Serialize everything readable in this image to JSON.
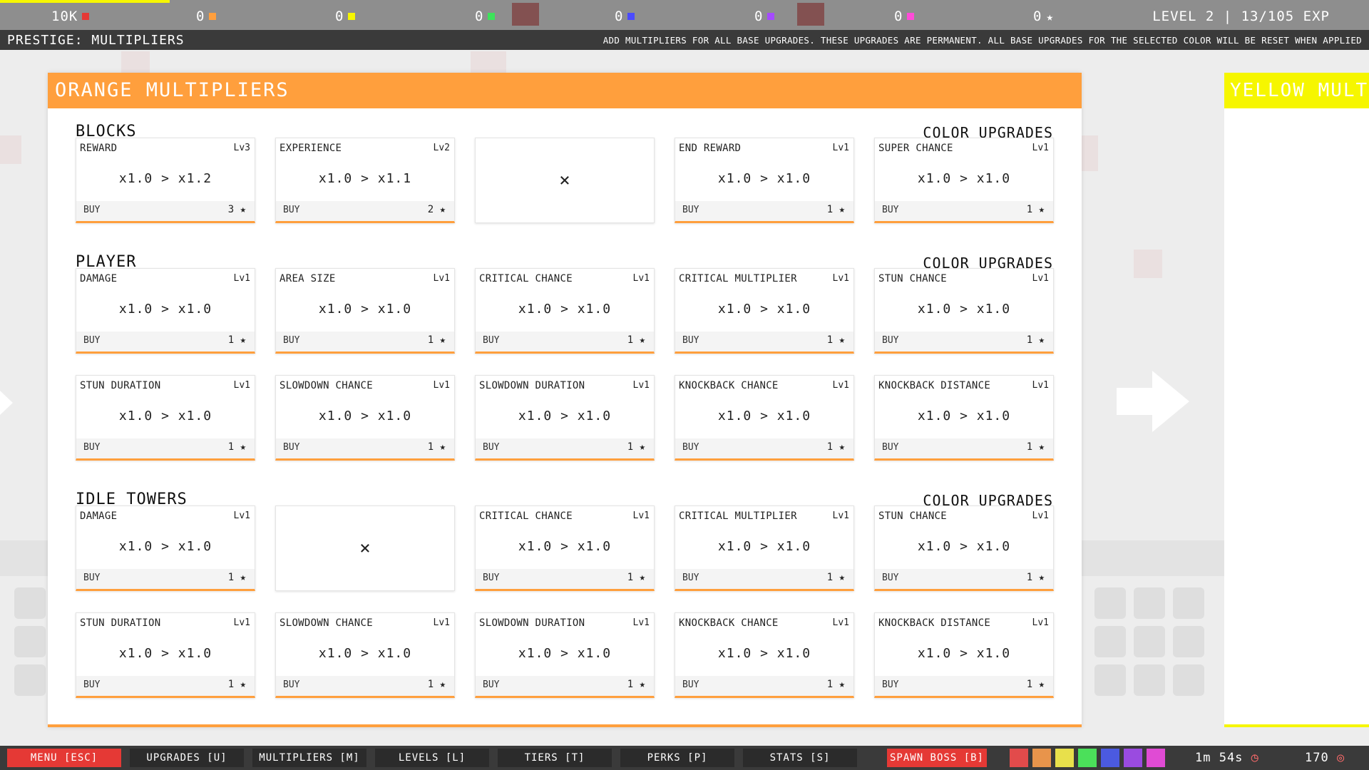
{
  "topbar": {
    "resources": [
      {
        "value": "10K",
        "color": "#e53935"
      },
      {
        "value": "0",
        "color": "#ff9f3d"
      },
      {
        "value": "0",
        "color": "#f6f600"
      },
      {
        "value": "0",
        "color": "#3de25a"
      },
      {
        "value": "0",
        "color": "#4b4bff"
      },
      {
        "value": "0",
        "color": "#a54bff"
      },
      {
        "value": "0",
        "color": "#ff4bd8"
      },
      {
        "value": "0",
        "icon": "star-icon"
      }
    ],
    "level_text": "LEVEL 2 | 13/105 EXP"
  },
  "subbar": {
    "title": "PRESTIGE: MULTIPLIERS",
    "description": "ADD MULTIPLIERS FOR ALL BASE UPGRADES. THESE UPGRADES ARE PERMANENT. ALL BASE UPGRADES FOR THE SELECTED COLOR WILL BE RESET WHEN APPLIED"
  },
  "panel": {
    "title": "ORANGE MULTIPLIERS",
    "accent": "#ff9f3d",
    "buy_label": "BUY",
    "color_upgrades_label": "COLOR UPGRADES",
    "sections": [
      {
        "title": "BLOCKS",
        "rows": [
          [
            {
              "name": "REWARD",
              "lv": "Lv3",
              "value": "x1.0 > x1.2",
              "cost": "3"
            },
            {
              "name": "EXPERIENCE",
              "lv": "Lv2",
              "value": "x1.0 > x1.1",
              "cost": "2"
            },
            {
              "empty": true,
              "mark": "×"
            },
            {
              "name": "END REWARD",
              "lv": "Lv1",
              "value": "x1.0 > x1.0",
              "cost": "1"
            },
            {
              "name": "SUPER CHANCE",
              "lv": "Lv1",
              "value": "x1.0 > x1.0",
              "cost": "1"
            }
          ]
        ]
      },
      {
        "title": "PLAYER",
        "rows": [
          [
            {
              "name": "DAMAGE",
              "lv": "Lv1",
              "value": "x1.0 > x1.0",
              "cost": "1"
            },
            {
              "name": "AREA SIZE",
              "lv": "Lv1",
              "value": "x1.0 > x1.0",
              "cost": "1"
            },
            {
              "name": "CRITICAL CHANCE",
              "lv": "Lv1",
              "value": "x1.0 > x1.0",
              "cost": "1"
            },
            {
              "name": "CRITICAL MULTIPLIER",
              "lv": "Lv1",
              "value": "x1.0 > x1.0",
              "cost": "1"
            },
            {
              "name": "STUN CHANCE",
              "lv": "Lv1",
              "value": "x1.0 > x1.0",
              "cost": "1"
            }
          ],
          [
            {
              "name": "STUN DURATION",
              "lv": "Lv1",
              "value": "x1.0 > x1.0",
              "cost": "1"
            },
            {
              "name": "SLOWDOWN CHANCE",
              "lv": "Lv1",
              "value": "x1.0 > x1.0",
              "cost": "1"
            },
            {
              "name": "SLOWDOWN DURATION",
              "lv": "Lv1",
              "value": "x1.0 > x1.0",
              "cost": "1"
            },
            {
              "name": "KNOCKBACK CHANCE",
              "lv": "Lv1",
              "value": "x1.0 > x1.0",
              "cost": "1"
            },
            {
              "name": "KNOCKBACK DISTANCE",
              "lv": "Lv1",
              "value": "x1.0 > x1.0",
              "cost": "1"
            }
          ]
        ]
      },
      {
        "title": "IDLE TOWERS",
        "rows": [
          [
            {
              "name": "DAMAGE",
              "lv": "Lv1",
              "value": "x1.0 > x1.0",
              "cost": "1"
            },
            {
              "empty": true,
              "mark": "×"
            },
            {
              "name": "CRITICAL CHANCE",
              "lv": "Lv1",
              "value": "x1.0 > x1.0",
              "cost": "1"
            },
            {
              "name": "CRITICAL MULTIPLIER",
              "lv": "Lv1",
              "value": "x1.0 > x1.0",
              "cost": "1"
            },
            {
              "name": "STUN CHANCE",
              "lv": "Lv1",
              "value": "x1.0 > x1.0",
              "cost": "1"
            }
          ],
          [
            {
              "name": "STUN DURATION",
              "lv": "Lv1",
              "value": "x1.0 > x1.0",
              "cost": "1"
            },
            {
              "name": "SLOWDOWN CHANCE",
              "lv": "Lv1",
              "value": "x1.0 > x1.0",
              "cost": "1"
            },
            {
              "name": "SLOWDOWN DURATION",
              "lv": "Lv1",
              "value": "x1.0 > x1.0",
              "cost": "1"
            },
            {
              "name": "KNOCKBACK CHANCE",
              "lv": "Lv1",
              "value": "x1.0 > x1.0",
              "cost": "1"
            },
            {
              "name": "KNOCKBACK DISTANCE",
              "lv": "Lv1",
              "value": "x1.0 > x1.0",
              "cost": "1"
            }
          ]
        ]
      }
    ]
  },
  "side_panel": {
    "title": "YELLOW MULT",
    "accent": "#f6f600"
  },
  "bottombar": {
    "buttons": [
      {
        "label": "MENU [ESC]",
        "accent": "#e53935"
      },
      {
        "label": "UPGRADES [U]"
      },
      {
        "label": "MULTIPLIERS [M]"
      },
      {
        "label": "LEVELS [L]"
      },
      {
        "label": "TIERS [T]"
      },
      {
        "label": "PERKS [P]"
      },
      {
        "label": "STATS [S]"
      }
    ],
    "spawn_boss": "SPAWN BOSS [B]",
    "color_swatches": [
      "#e24b4b",
      "#e8944b",
      "#e8e04b",
      "#4be05a",
      "#4b5ae0",
      "#9a4be0",
      "#e04bd4"
    ],
    "timer": "1m 54s",
    "timer_icon": "clock-icon",
    "count": "170",
    "count_icon": "target-icon"
  }
}
